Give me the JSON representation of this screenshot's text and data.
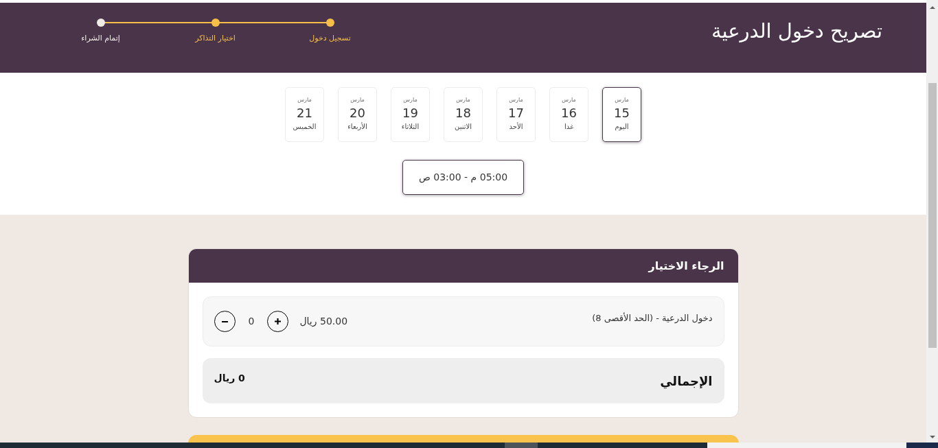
{
  "header": {
    "title": "تصريح دخول الدرعية",
    "steps": [
      {
        "label": "تسجيل دخول",
        "active": true
      },
      {
        "label": "اختيار التذاكر",
        "active": true
      },
      {
        "label": "إتمام الشراء",
        "active": false
      }
    ]
  },
  "dates": [
    {
      "month": "مارس",
      "day": "15",
      "weekday": "اليوم",
      "selected": true
    },
    {
      "month": "مارس",
      "day": "16",
      "weekday": "غدا",
      "selected": false
    },
    {
      "month": "مارس",
      "day": "17",
      "weekday": "الأحد",
      "selected": false
    },
    {
      "month": "مارس",
      "day": "18",
      "weekday": "الاثنين",
      "selected": false
    },
    {
      "month": "مارس",
      "day": "19",
      "weekday": "الثلاثاء",
      "selected": false
    },
    {
      "month": "مارس",
      "day": "20",
      "weekday": "الأربعاء",
      "selected": false
    },
    {
      "month": "مارس",
      "day": "21",
      "weekday": "الخميس",
      "selected": false
    }
  ],
  "time_slots": [
    {
      "label": "05:00 م - 03:00 ص",
      "selected": true
    }
  ],
  "ticket_panel": {
    "title": "الرجاء الاختيار",
    "tickets": [
      {
        "name": "دخول الدرعية - (الحد الأقصى 8)",
        "price": "50.00 ريال",
        "quantity": "0"
      }
    ],
    "total": {
      "label": "الإجمالي",
      "value": "0 ريال"
    }
  }
}
